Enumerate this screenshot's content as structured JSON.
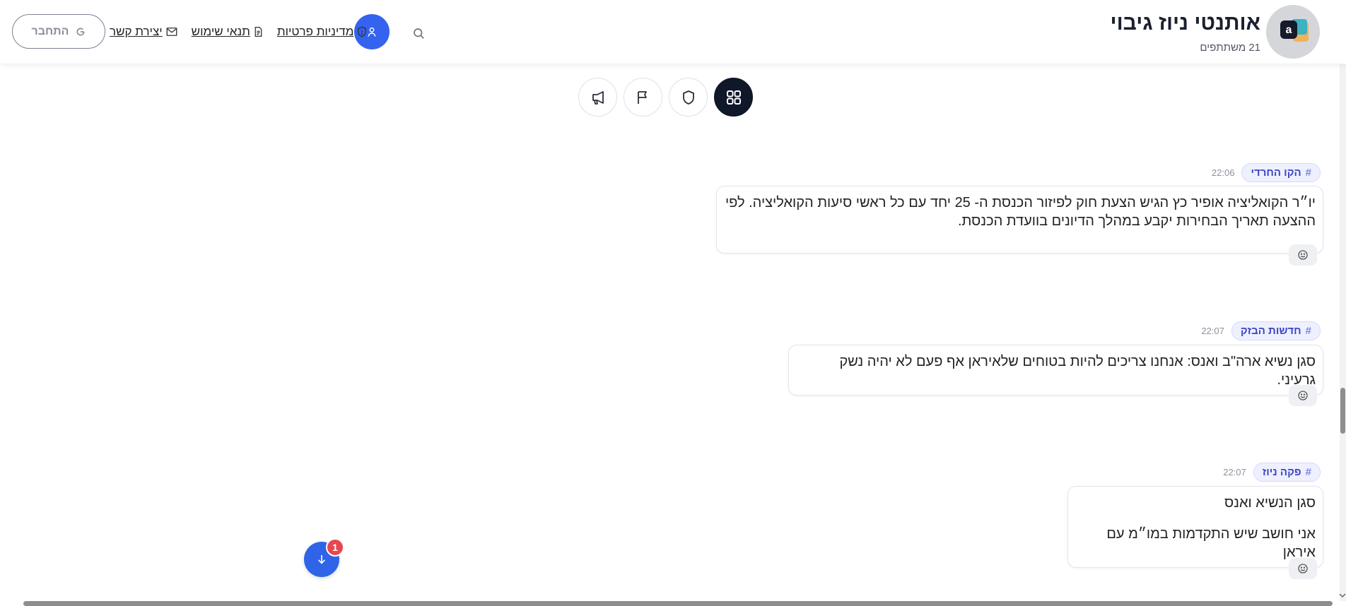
{
  "header": {
    "title": "אותנטי ניוז גיבוי",
    "members": "21 משתתפים",
    "nav": [
      {
        "label": "מדיניות פרטיות",
        "icon": "shield-icon"
      },
      {
        "label": "תנאי שימוש",
        "icon": "document-icon"
      },
      {
        "label": "יצירת קשר",
        "icon": "mail-icon"
      }
    ],
    "login_label": "התחבר",
    "login_icon": "google-icon",
    "search_icon": "search-icon",
    "user_icon": "user-icon"
  },
  "filters": [
    {
      "name": "all",
      "icon": "grid-icon",
      "active": true
    },
    {
      "name": "security",
      "icon": "shield-icon",
      "active": false
    },
    {
      "name": "flag",
      "icon": "flag-icon",
      "active": false
    },
    {
      "name": "announcements",
      "icon": "megaphone-icon",
      "active": false
    }
  ],
  "messages": [
    {
      "tag": "הקו החרדי",
      "time": "22:06",
      "lines": [
        "יו״ר הקואליציה אופיר כץ הגיש הצעת חוק לפיזור הכנסת ה- 25 יחד עם כל ראשי סיעות הקואליציה. לפי ההצעה תאריך הבחירות יקבע במהלך הדיונים בוועדת הכנסת."
      ]
    },
    {
      "tag": "חדשות הבזק",
      "time": "22:07",
      "lines": [
        "סגן נשיא ארה\"ב ואנס: אנחנו צריכים להיות בטוחים שלאיראן אף פעם לא יהיה נשק גרעיני."
      ]
    },
    {
      "tag": "פקה ניוז",
      "time": "22:07",
      "lines": [
        "סגן הנשיא ואנס",
        "אני חושב שיש התקדמות במו״מ עם איראן"
      ]
    }
  ],
  "unread_count": "1",
  "colors": {
    "primary": "#3563f0",
    "dark": "#0f1729",
    "tag_bg": "#eef0ff",
    "tag_text": "#3b46c4",
    "badge": "#e5484d"
  }
}
